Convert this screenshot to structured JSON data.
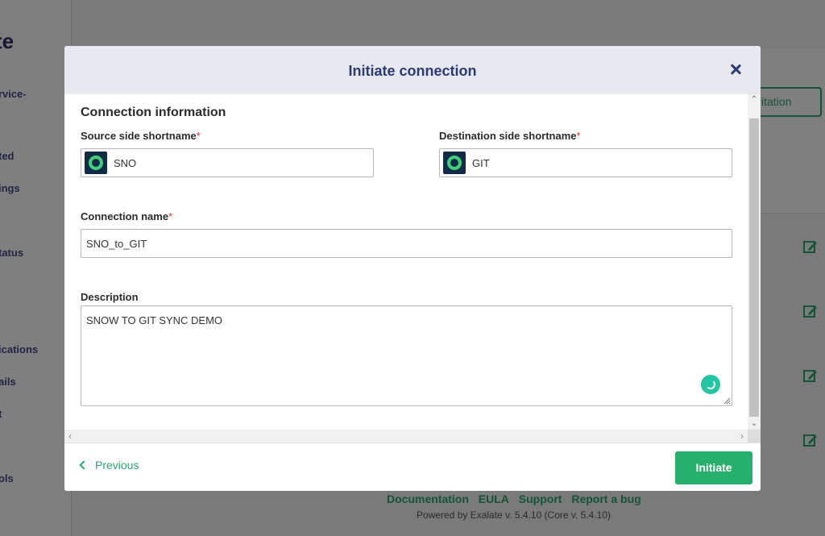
{
  "background": {
    "logo_fragment": "te",
    "nav_items": [
      {
        "label": "rvice-"
      },
      {
        "label": "ted"
      },
      {
        "label": "ings"
      },
      {
        "label": "tatus"
      },
      {
        "label": "ications"
      },
      {
        "label": "ails"
      },
      {
        "label": "t"
      },
      {
        "label": "ols"
      }
    ],
    "invitation_button": "vitation",
    "footer_links": [
      "Documentation",
      "EULA",
      "Support",
      "Report a bug"
    ],
    "powered_by": "Powered by Exalate v. 5.4.10 (Core v. 5.4.10)"
  },
  "modal": {
    "title": "Initiate connection",
    "section_title": "Connection information",
    "source": {
      "label": "Source side shortname",
      "required_mark": "*",
      "value": "SNO"
    },
    "destination": {
      "label": "Destination side shortname",
      "required_mark": "*",
      "value": "GIT"
    },
    "connection_name": {
      "label": "Connection name",
      "required_mark": "*",
      "value": "SNO_to_GIT"
    },
    "description": {
      "label": "Description",
      "value": "SNOW TO GIT SYNC DEMO"
    },
    "footer": {
      "previous_label": "Previous",
      "initiate_label": "Initiate"
    }
  },
  "colors": {
    "accent_green": "#27b06b",
    "title_blue": "#2d3a78",
    "header_bg": "#e8e8f1",
    "required_red": "#d0312d"
  },
  "icons": [
    "close-icon",
    "exalate-node-icon",
    "loading-spinner-icon",
    "chevron-left-icon",
    "edit-icon"
  ]
}
